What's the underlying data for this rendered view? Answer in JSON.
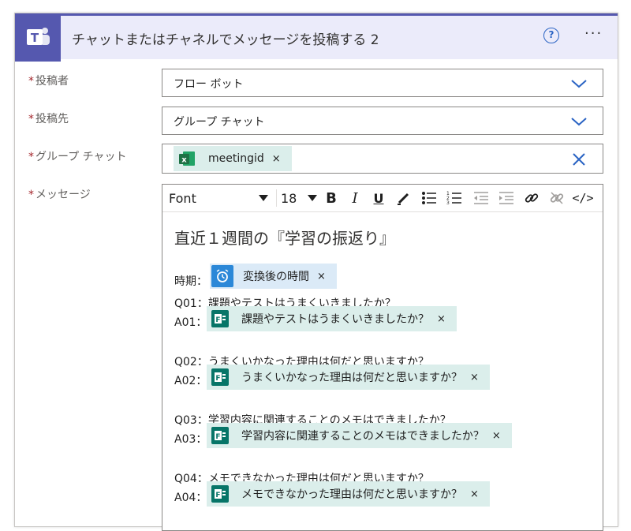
{
  "header": {
    "title": "チャットまたはチャネルでメッセージを投稿する 2",
    "help_label": "?",
    "more_label": "···"
  },
  "fields": {
    "poster": {
      "required": "*",
      "label": "投稿者",
      "value": "フロー ボット"
    },
    "post_in": {
      "required": "*",
      "label": "投稿先",
      "value": "グループ チャット"
    },
    "group_chat": {
      "required": "*",
      "label": "グループ チャット",
      "token": "meetingid",
      "token_remove": "×"
    },
    "message": {
      "required": "*",
      "label": "メッセージ"
    }
  },
  "toolbar": {
    "font": "Font",
    "size": "18",
    "bold": "B",
    "italic": "I",
    "underline": "U",
    "code": "</>"
  },
  "editor": {
    "heading": "直近１週間の『学習の振返り』",
    "period_label": "時期：",
    "period_token": "変換後の時間",
    "qa": [
      {
        "q": "Q01：課題やテストはうまくいきましたか？",
        "a_label": "A01：",
        "token": "課題やテストはうまくいきましたか？"
      },
      {
        "q": "Q02：うまくいかなった理由は何だと思いますか？",
        "a_label": "A02：",
        "token": "うまくいかなった理由は何だと思いますか？"
      },
      {
        "q": "Q03：学習内容に関連することのメモはできましたか？",
        "a_label": "A03：",
        "token": "学習内容に関連することのメモはできましたか？"
      },
      {
        "q": "Q04：メモできなかった理由は何だと思いますか？",
        "a_label": "A04：",
        "token": "メモできなかった理由は何だと思いますか？"
      }
    ],
    "token_remove": "×"
  },
  "colors": {
    "teams_purple": "#5558af",
    "header_bg": "#ebebfa",
    "excel_green": "#1e7145",
    "forms_teal": "#077568",
    "chip_bg": "#dbeeeb",
    "link_blue": "#2b64c4",
    "required_red": "#a4262c"
  },
  "icons": [
    "teams-icon",
    "help-icon",
    "more-icon",
    "chevron-down-icon",
    "excel-icon",
    "clear-icon",
    "alarm-clock-icon",
    "forms-icon"
  ]
}
